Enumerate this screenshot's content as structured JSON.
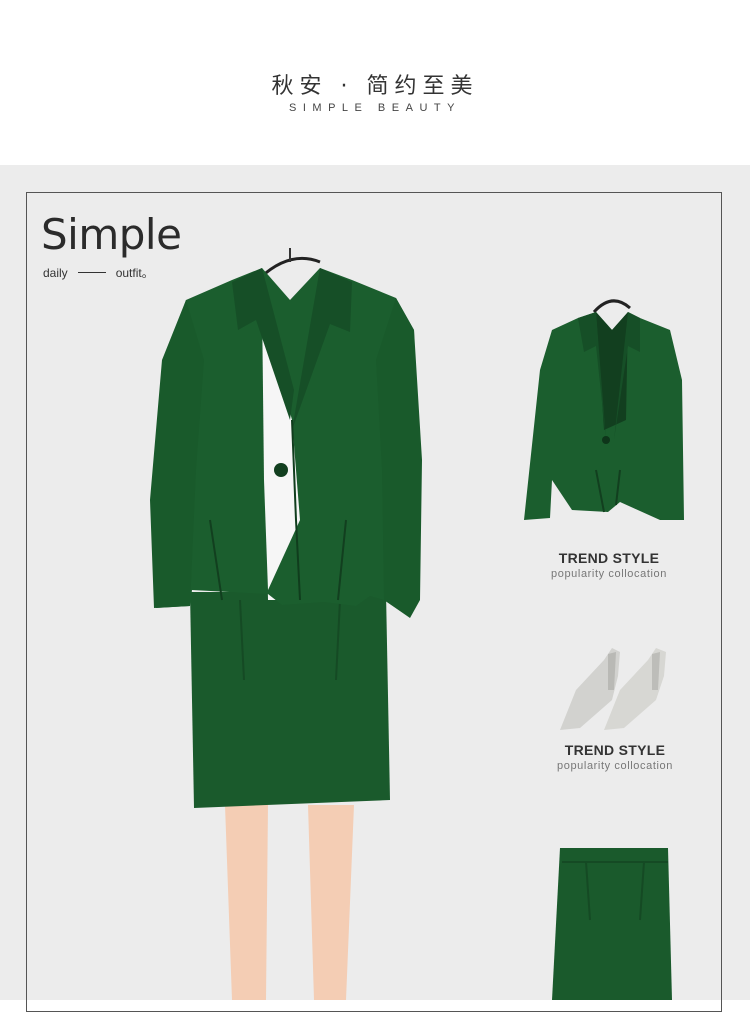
{
  "header": {
    "title": "秋安 · 简约至美",
    "subtitle": "SIMPLE BEAUTY"
  },
  "intro": {
    "headline": "Simple",
    "word_left": "daily",
    "word_right": "outfit。"
  },
  "products": [
    {
      "name": "blazer",
      "title": "TREND STYLE",
      "subtitle": "popularity collocation"
    },
    {
      "name": "heels",
      "title": "TREND STYLE",
      "subtitle": "popularity collocation"
    },
    {
      "name": "skirt"
    }
  ],
  "colors": {
    "garment_green": "#1a5a2c",
    "panel_gray": "#ececec",
    "heel_gray": "#d2d2cf",
    "skin": "#f4cdb4"
  }
}
